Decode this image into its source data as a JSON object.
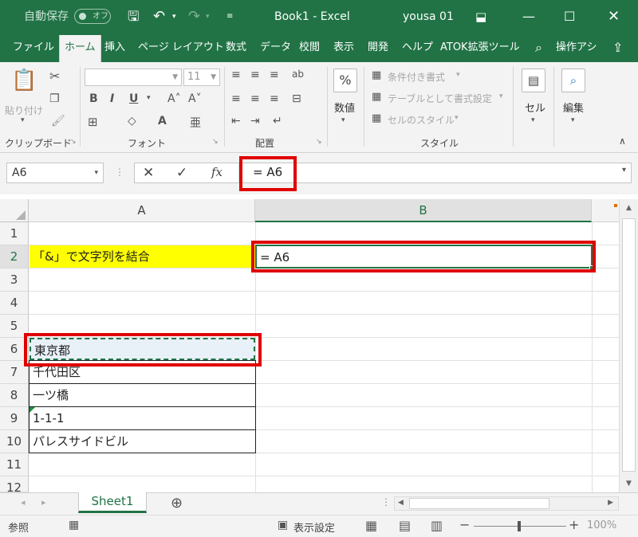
{
  "titlebar": {
    "autosave": "自動保存",
    "autosave_state": "オフ",
    "title": "Book1  -  Excel",
    "user": "yousa 01"
  },
  "tabs": [
    "ファイル",
    "ホーム",
    "挿入",
    "ページ レイアウト",
    "数式",
    "データ",
    "校閲",
    "表示",
    "開発",
    "ヘルプ",
    "ATOK拡張ツール"
  ],
  "tell_me": "操作アシ",
  "ribbon": {
    "clipboard": {
      "paste": "貼り付け",
      "label": "クリップボード"
    },
    "font": {
      "name": "",
      "size": "11",
      "label": "フォント",
      "bold": "B",
      "italic": "I",
      "underline": "U"
    },
    "alignment": {
      "label": "配置"
    },
    "number": {
      "label": "数値",
      "symbol": "%"
    },
    "styles": {
      "label": "スタイル",
      "cond": "条件付き書式",
      "table": "テーブルとして書式設定",
      "cell": "セルのスタイル"
    },
    "cells": {
      "label": "セル"
    },
    "editing": {
      "label": "編集"
    }
  },
  "formula_bar": {
    "name_box": "A6",
    "formula": "= A6",
    "fx": "fx"
  },
  "columns": [
    "A",
    "B"
  ],
  "rows": [
    "1",
    "2",
    "3",
    "4",
    "5",
    "6",
    "7",
    "8",
    "9",
    "10",
    "11",
    "12"
  ],
  "cells": {
    "A2": "「&」で文字列を結合",
    "B2": "= A6",
    "A6": "東京都",
    "A7": "千代田区",
    "A8": "一ツ橋",
    "A9": "1-1-1",
    "A10": "パレスサイドビル"
  },
  "sheet_tab": "Sheet1",
  "status": {
    "mode": "参照",
    "display_settings": "表示設定",
    "zoom": "100%"
  },
  "colors": {
    "excel_green": "#217346",
    "highlight": "#ffff00",
    "red_box": "#e00000"
  }
}
